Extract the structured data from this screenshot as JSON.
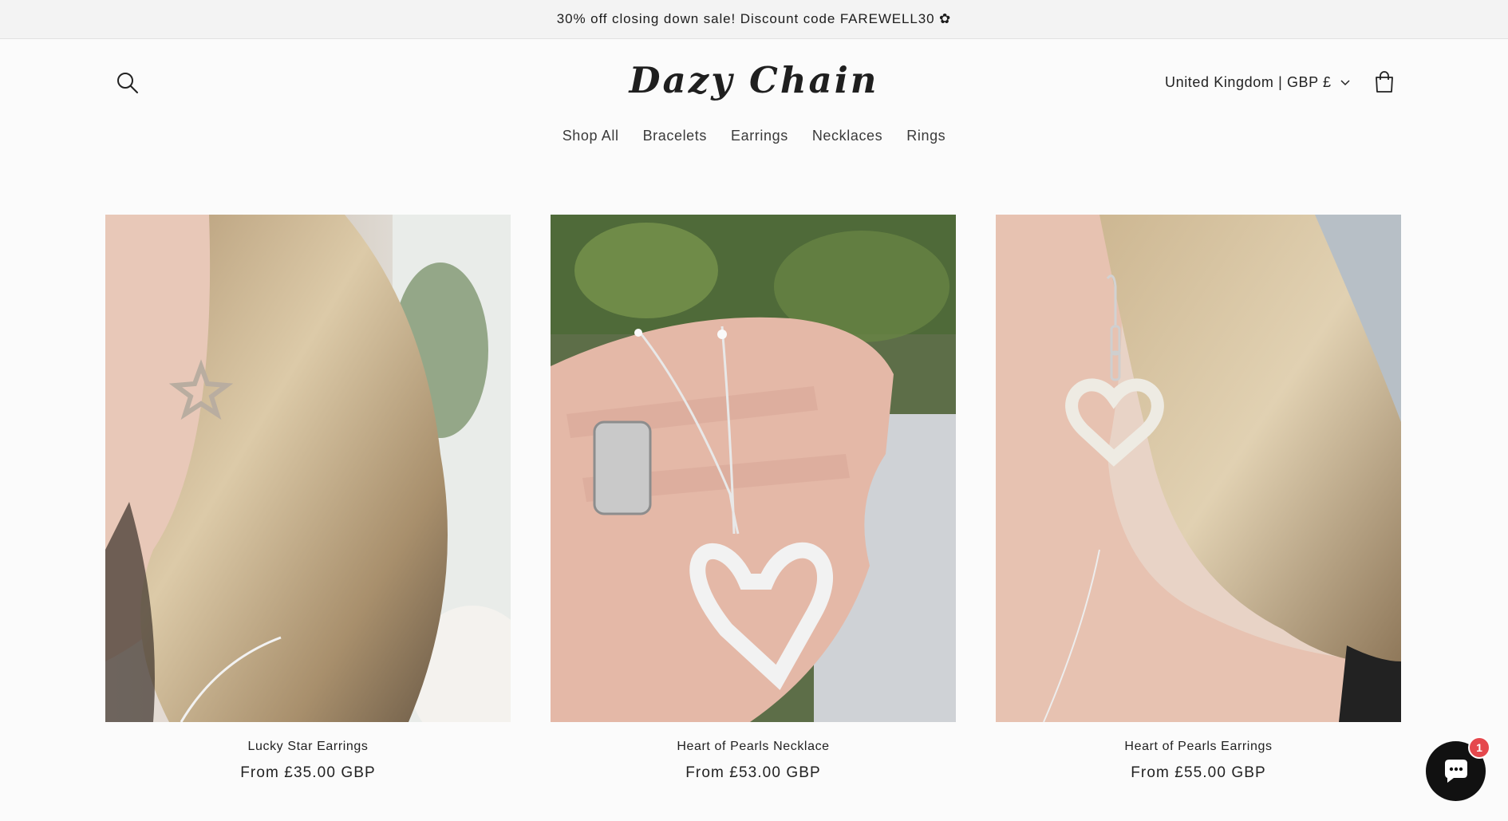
{
  "announcement": {
    "text": "30% off closing down sale! Discount code FAREWELL30 ✿"
  },
  "header": {
    "logo": "Dazy Chain",
    "search_icon": "search-icon",
    "country_selector": "United Kingdom | GBP £",
    "cart_icon": "cart-icon"
  },
  "nav": {
    "items": [
      {
        "label": "Shop All"
      },
      {
        "label": "Bracelets"
      },
      {
        "label": "Earrings"
      },
      {
        "label": "Necklaces"
      },
      {
        "label": "Rings"
      }
    ]
  },
  "products": [
    {
      "title": "Lucky Star Earrings",
      "price": "From £35.00 GBP"
    },
    {
      "title": "Heart of Pearls Necklace",
      "price": "From £53.00 GBP"
    },
    {
      "title": "Heart of Pearls Earrings",
      "price": "From £55.00 GBP"
    }
  ],
  "chat": {
    "icon": "chat-bubble-icon",
    "badge_count": "1"
  },
  "colors": {
    "background": "#fbfbfb",
    "announcement_bg": "#f3f3f3",
    "text": "#222222",
    "badge": "#e5484d"
  }
}
